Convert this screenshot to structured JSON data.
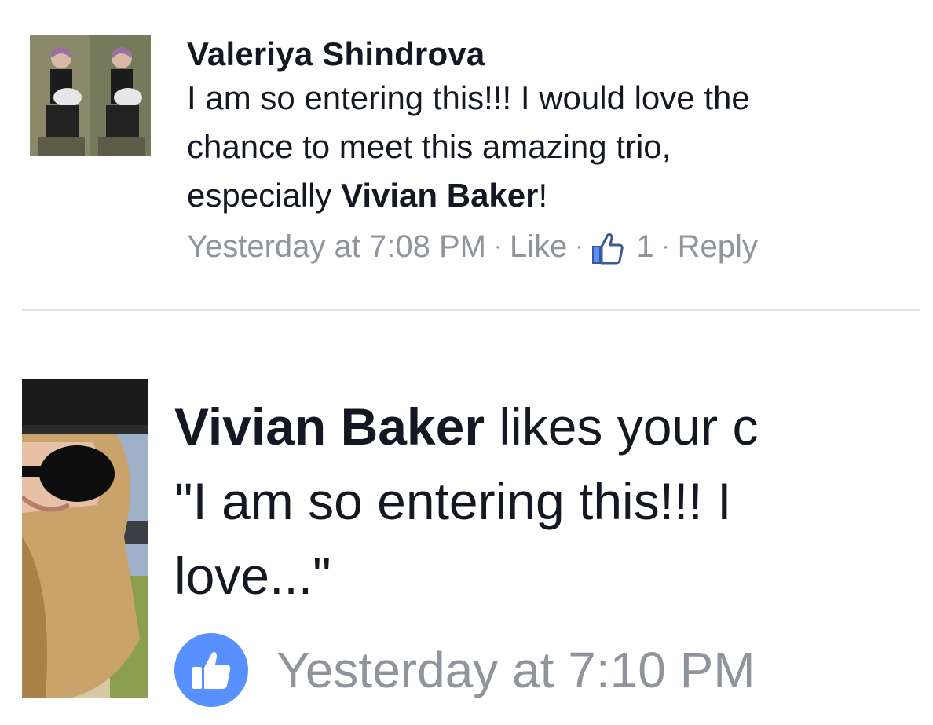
{
  "comment": {
    "author": "Valeriya Shindrova",
    "text_line1": "I am so entering this!!! I would love the",
    "text_line2": "chance to meet this amazing trio,",
    "text_line3_prefix": "especially ",
    "mention": "Vivian Baker",
    "text_line3_suffix": "!",
    "timestamp": "Yesterday at 7:08 PM",
    "separator": "·",
    "like_label": "Like",
    "like_count": "1",
    "reply_label": "Reply",
    "icons": {
      "like_count_icon": "thumbs-up-outline-icon"
    }
  },
  "notification": {
    "actor": "Vivian Baker",
    "action_text": " likes your c",
    "quote_line1": "\"I am so entering this!!! I",
    "quote_line2": "love...\"",
    "timestamp": "Yesterday at 7:10 PM",
    "icons": {
      "badge_icon": "thumbs-up-icon"
    },
    "badge_color": "#5890ff"
  }
}
